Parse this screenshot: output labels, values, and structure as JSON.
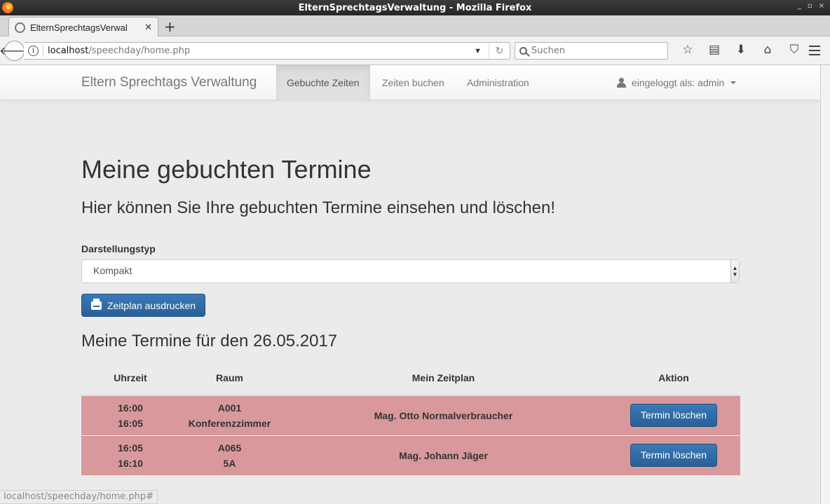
{
  "window": {
    "title": "ElternSprechtagsVerwaltung - Mozilla Firefox",
    "buttons": [
      "_",
      "▫",
      "×"
    ]
  },
  "browser": {
    "tab_label": "ElternSprechtagsVerwal",
    "url_host": "localhost",
    "url_path": "/speechday/home.php",
    "search_placeholder": "Suchen",
    "status_url": "localhost/speechday/home.php#"
  },
  "app": {
    "brand": "Eltern Sprechtags Verwaltung",
    "nav": [
      "Gebuchte Zeiten",
      "Zeiten buchen",
      "Administration"
    ],
    "active_nav": "Gebuchte Zeiten",
    "user_label": "eingeloggt als: admin"
  },
  "main": {
    "title": "Meine gebuchten Termine",
    "subtitle": "Hier können Sie Ihre gebuchten Termine einsehen und löschen!",
    "display_type_label": "Darstellungstyp",
    "display_type_value": "Kompakt",
    "print_button": "Zeitplan ausdrucken",
    "date_heading": "Meine Termine für den 26.05.2017"
  },
  "table": {
    "headers": [
      "Uhrzeit",
      "Raum",
      "Mein Zeitplan",
      "Aktion"
    ],
    "rows": [
      {
        "start": "16:00",
        "end": "16:05",
        "room_code": "A001",
        "room_name": "Konferenzzimmer",
        "teacher": "Mag. Otto Normalverbraucher",
        "action": "Termin löschen"
      },
      {
        "start": "16:05",
        "end": "16:10",
        "room_code": "A065",
        "room_name": "5A",
        "teacher": "Mag. Johann Jäger",
        "action": "Termin löschen"
      }
    ]
  },
  "colors": {
    "row_background": "#d8989c",
    "button_blue": "#2d6ca2"
  }
}
